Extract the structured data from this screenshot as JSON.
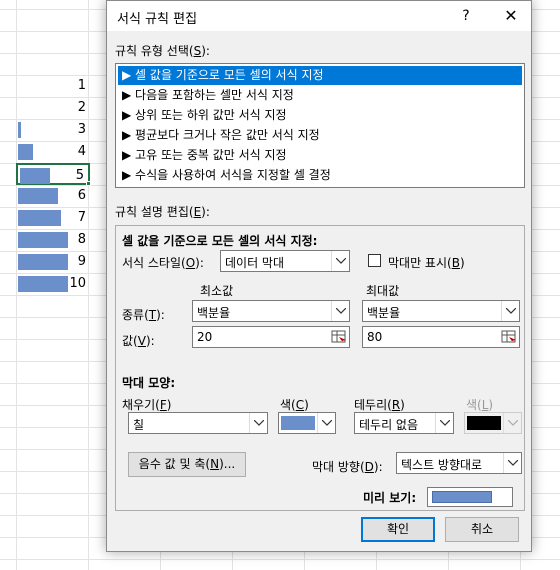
{
  "colors": {
    "bar": "#6b8fcb",
    "selection": "#0078d7",
    "border_color": "#000000"
  },
  "sheet": {
    "rows": [
      {
        "value": "1",
        "bar_fraction": 0.0
      },
      {
        "value": "2",
        "bar_fraction": 0.0
      },
      {
        "value": "3",
        "bar_fraction": 0.04
      },
      {
        "value": "4",
        "bar_fraction": 0.21
      },
      {
        "value": "5",
        "bar_fraction": 0.43
      },
      {
        "value": "6",
        "bar_fraction": 0.57
      },
      {
        "value": "7",
        "bar_fraction": 0.61
      },
      {
        "value": "8",
        "bar_fraction": 0.71
      },
      {
        "value": "9",
        "bar_fraction": 0.71
      },
      {
        "value": "10",
        "bar_fraction": 0.71
      }
    ],
    "active_row": 4
  },
  "dialog": {
    "title": "서식 규칙 편집",
    "help_glyph": "?",
    "close_glyph": "✕",
    "rule_type_label": "규칙 유형 선택(",
    "rule_type_key": "S",
    "rule_type_suffix": "):",
    "rule_types": [
      "▶ 셀 값을 기준으로 모든 셀의 서식 지정",
      "▶ 다음을 포함하는 셀만 서식 지정",
      "▶ 상위 또는 하위 값만 서식 지정",
      "▶ 평균보다 크거나 작은 값만 서식 지정",
      "▶ 고유 또는 중복 값만 서식 지정",
      "▶ 수식을 사용하여 서식을 지정할 셀 결정"
    ],
    "selected_rule_index": 0,
    "rule_desc_label": "규칙 설명 편집(",
    "rule_desc_key": "E",
    "rule_desc_suffix": "):",
    "section_title": "셀 값을 기준으로 모든 셀의 서식 지정:",
    "format_style_label": "서식 스타일(",
    "format_style_key": "O",
    "format_style_suffix": "):",
    "format_style_value": "데이터 막대",
    "show_bar_only_label": "막대만 표시(",
    "show_bar_only_key": "B",
    "show_bar_only_suffix": ")",
    "show_bar_only_checked": false,
    "min_header": "최소값",
    "max_header": "최대값",
    "type_label": "종류(",
    "type_key": "T",
    "type_suffix": "):",
    "min_type": "백분율",
    "max_type": "백분율",
    "value_label": "값(",
    "value_key": "V",
    "value_suffix": "):",
    "min_value": "20",
    "max_value": "80",
    "bar_look_title": "막대 모양:",
    "fill_label": "채우기(",
    "fill_key": "F",
    "fill_suffix": ")",
    "fill_value": "칠",
    "color_label": "색(",
    "color_key": "C",
    "color_suffix": ")",
    "border_label": "테두리(",
    "border_key": "R",
    "border_suffix": ")",
    "border_value": "테두리 없음",
    "border_color_label": "색(",
    "border_color_key": "L",
    "border_color_suffix": ")",
    "negative_button": "음수 값 및 축(",
    "negative_key": "N",
    "negative_suffix": ")...",
    "bar_direction_label": "막대 방향(",
    "bar_direction_key": "D",
    "bar_direction_suffix": "):",
    "bar_direction_value": "텍스트 방향대로",
    "preview_label": "미리 보기:",
    "ok_label": "확인",
    "cancel_label": "취소"
  }
}
